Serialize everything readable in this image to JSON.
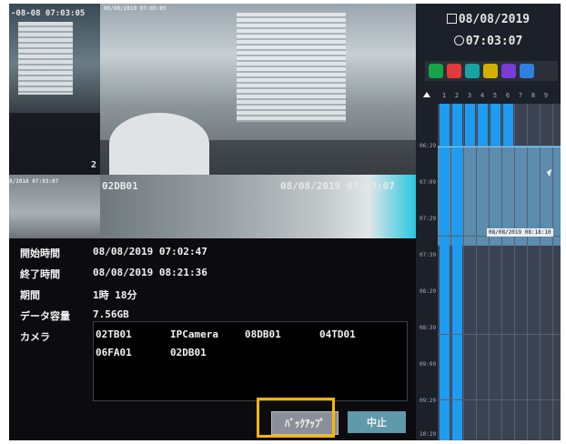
{
  "tiles": {
    "t1_timestamp": "-08-08 07:03:05",
    "t1_number": "2",
    "t2_overlay": "08/08/2019 07:03:05",
    "t3_timestamp": "8/2018 07:03:07",
    "t4_camera": "02DB01",
    "t4_timestamp": "08/08/2019 07:03:07"
  },
  "panel": {
    "date": "08/08/2019",
    "time": "07:03:07",
    "channel_colors": [
      "#17a34a",
      "#e23b3b",
      "#1aa3a3",
      "#d3b000",
      "#7a3bd6",
      "#2f7fe0"
    ],
    "timeline_numbers": [
      "1",
      "2",
      "3",
      "4",
      "5",
      "6",
      "7",
      "8",
      "9"
    ],
    "time_labels": [
      "06:29",
      "07:09",
      "07:29",
      "07:39",
      "08:29",
      "08:39",
      "09:09",
      "09:29",
      "10:29",
      "10:39"
    ],
    "segment_tag": "08/08/2019 08:18:10"
  },
  "dialog": {
    "start_label": "開始時間",
    "start_value": "08/08/2019 07:02:47",
    "end_label": "終了時間",
    "end_value": "08/08/2019 08:21:36",
    "duration_label": "期間",
    "duration_value": "1時 18分",
    "size_label": "データ容量",
    "size_value": "7.56GB",
    "camera_label": "カメラ",
    "cameras": [
      "02TB01",
      "IPCamera",
      "08DB01",
      "04TD01",
      "06FA01",
      "02DB01"
    ],
    "backup_label": "ﾊﾞｯｸｱｯﾌﾟ",
    "cancel_label": "中止"
  }
}
